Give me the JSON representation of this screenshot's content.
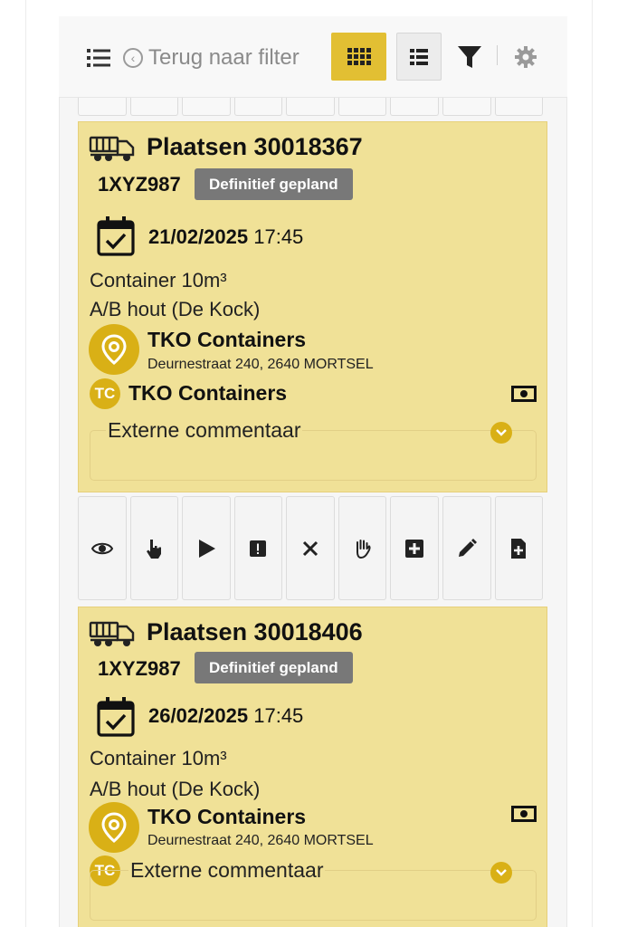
{
  "toolbar": {
    "back_label": "Terug naar filter",
    "icons": [
      "list-icon",
      "back-circle-icon",
      "grid-view-icon",
      "list-view-icon",
      "filter-icon",
      "gear-icon"
    ]
  },
  "cards": [
    {
      "title": "Plaatsen 30018367",
      "plate": "1XYZ987",
      "status": "Definitief gepland",
      "date": "21/02/2025",
      "time": "17:45",
      "container": "Container 10m³",
      "material": "A/B hout (De Kock)",
      "location_name": "TKO Containers",
      "location_address": "Deurnestraat 240, 2640 MORTSEL",
      "customer_initials": "TC",
      "customer_name": "TKO Containers",
      "comment_label": "Externe commentaar"
    },
    {
      "title": "Plaatsen 30018406",
      "plate": "1XYZ987",
      "status": "Definitief gepland",
      "date": "26/02/2025",
      "time": "17:45",
      "container": "Container 10m³",
      "material": "A/B hout (De Kock)",
      "location_name": "TKO Containers",
      "location_address": "Deurnestraat 240, 2640 MORTSEL",
      "customer_initials": "TC",
      "comment_label": "Externe commentaar"
    }
  ],
  "actions": [
    "view-icon",
    "pointer-hand-icon",
    "play-icon",
    "alert-icon",
    "close-icon",
    "stop-hand-icon",
    "add-icon",
    "edit-icon",
    "add-document-icon"
  ],
  "colors": {
    "accent": "#e2bf33",
    "card_bg": "#f0e197",
    "badge_bg": "#787878",
    "icon_gold": "#d9b016"
  }
}
